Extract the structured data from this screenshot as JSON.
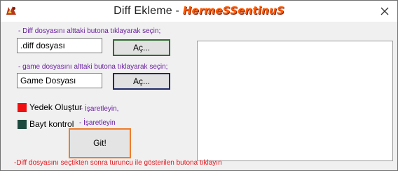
{
  "window": {
    "title_text": "Diff Ekleme - ",
    "title_brand": "HermeSSentinuS",
    "brand_color": "#ff5a00"
  },
  "diff": {
    "instruction": "- Diff dosyasını alttaki butona tıklayarak seçin;",
    "field_value": ".diff dosyası",
    "button_label": "Aç..."
  },
  "game": {
    "instruction": "- game dosyasını alttaki butona tıklayarak seçin;",
    "field_value": "Game Dosyası",
    "button_label": "Aç..."
  },
  "options": {
    "backup_label": "Yedek Oluştur",
    "backup_hint": "- İşaretleyin,",
    "backup_color": "#ef1111",
    "bytecontrol_label": "Bayt kontrol",
    "bytecontrol_hint": "- İşaretleyin",
    "bytecontrol_color": "#1c4a3e"
  },
  "go_button": {
    "label": "Git!"
  },
  "footer": {
    "text": "-Diff dosyasını seçtikten sonra turuncu ile gösterilen butona tıklayın"
  },
  "icons": {
    "app": "app-icon",
    "close": "close-icon"
  }
}
